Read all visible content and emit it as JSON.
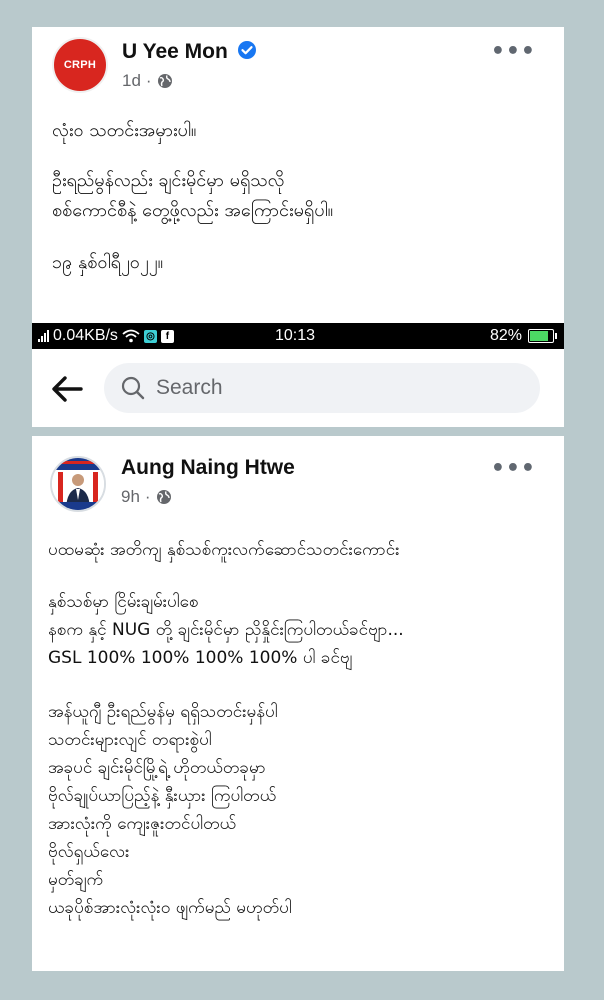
{
  "post1": {
    "author": "U Yee Mon",
    "avatar_text": "CRPH",
    "verified": true,
    "time": "1d",
    "privacy_icon": "globe-icon",
    "text_lines": [
      "လုံးဝ သတင်းအမှားပါ။",
      "",
      "ဦးရည်မွန်လည်း ချင်းမိုင်မှာ မရှိသလို",
      "စစ်ကောင်စီနဲ့ တွေ့ဖို့လည်း အကြောင်းမရှိပါ။",
      "",
      "၁၉ နှစ်ဝါရီ၂၀၂၂။"
    ]
  },
  "status_bar": {
    "speed": "0.04KB/s",
    "time": "10:13",
    "battery": "82%",
    "battery_level": 0.82,
    "accent": "#4cd964"
  },
  "search": {
    "placeholder": "Search"
  },
  "post2": {
    "author": "Aung Naing Htwe",
    "time": "9h",
    "privacy_icon": "globe-icon",
    "text_lines": [
      "ပထမဆုံး အတိကျ နှစ်သစ်ကူးလက်ဆောင်သတင်းကောင်း",
      "",
      "နှစ်သစ်မှာ ငြိမ်းချမ်းပါစေ",
      "နစက နှင့် NUG တို့ ချင်းမိုင်မှာ ညှိနှိုင်းကြပါတယ်ခင်ဗျာ...",
      "GSL 100%   100%  100%  100% ပါ ခင်ဗျ",
      "",
      "အန်ယူဂျီ ဦးရည်မွန်မှ ရရှိသတင်းမှန်ပါ",
      "သတင်းများလျင် တရားစွဲပါ",
      "အခုပင် ချင်းမိုင်မြို့ရဲ့ ဟိုတယ်တခုမှာ",
      "ဗိုလ်ချုပ်ယာပြည့်နဲ့ နှီးယှား ကြပါတယ်",
      "အားလုံးကို ကျေးဇူးတင်ပါတယ်",
      "ဗိုလ်ရှယ်လေး",
      "မှတ်ချက်",
      "ယခုပိုစ်အားလုံးလုံးဝ ဖျက်မည် မဟုတ်ပါ"
    ]
  },
  "colors": {
    "background": "#b9c9cc",
    "crph_red": "#d8261f",
    "verified_blue": "#1877f2",
    "meta_gray": "#65676b"
  }
}
